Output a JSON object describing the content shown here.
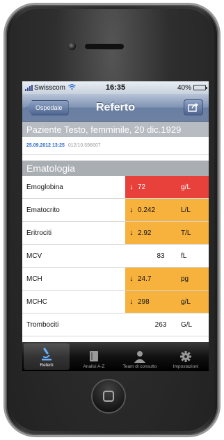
{
  "statusbar": {
    "carrier": "Swisscom",
    "time": "16:35",
    "battery": "40%",
    "battery_level": 0.4
  },
  "navbar": {
    "back_label": "Ospedale",
    "title": "Referto"
  },
  "patient": {
    "name_line": "Paziente Testo, femminile, 20 dic.1929",
    "datetime": "25.09.2012 13:25",
    "report_id": "012/10.596607"
  },
  "section": {
    "title": "Ematologia"
  },
  "results": [
    {
      "name": "Emoglobina",
      "arrow": "↓",
      "value": "72",
      "unit": "g/L",
      "status": "critical"
    },
    {
      "name": "Ematocrito",
      "arrow": "↓",
      "value": "0.242",
      "unit": "L/L",
      "status": "abnormal"
    },
    {
      "name": "Eritrociti",
      "arrow": "↓",
      "value": "2.92",
      "unit": "T/L",
      "status": "abnormal"
    },
    {
      "name": "MCV",
      "arrow": "",
      "value": "83",
      "unit": "fL",
      "status": "normal"
    },
    {
      "name": "MCH",
      "arrow": "↓",
      "value": "24.7",
      "unit": "pg",
      "status": "abnormal"
    },
    {
      "name": "MCHC",
      "arrow": "↓",
      "value": "298",
      "unit": "g/L",
      "status": "abnormal"
    },
    {
      "name": "Trombociti",
      "arrow": "",
      "value": "263",
      "unit": "G/L",
      "status": "normal"
    }
  ],
  "tabs": [
    {
      "label": "Referti",
      "icon": "microscope-icon",
      "active": true
    },
    {
      "label": "Analisi A-Z",
      "icon": "book-icon",
      "active": false
    },
    {
      "label": "Team di consulto",
      "icon": "person-icon",
      "active": false
    },
    {
      "label": "Impostazioni",
      "icon": "gear-icon",
      "active": false
    }
  ],
  "colors": {
    "critical": "#e8403a",
    "abnormal": "#f7b23e",
    "nav": "#6c81a4"
  }
}
